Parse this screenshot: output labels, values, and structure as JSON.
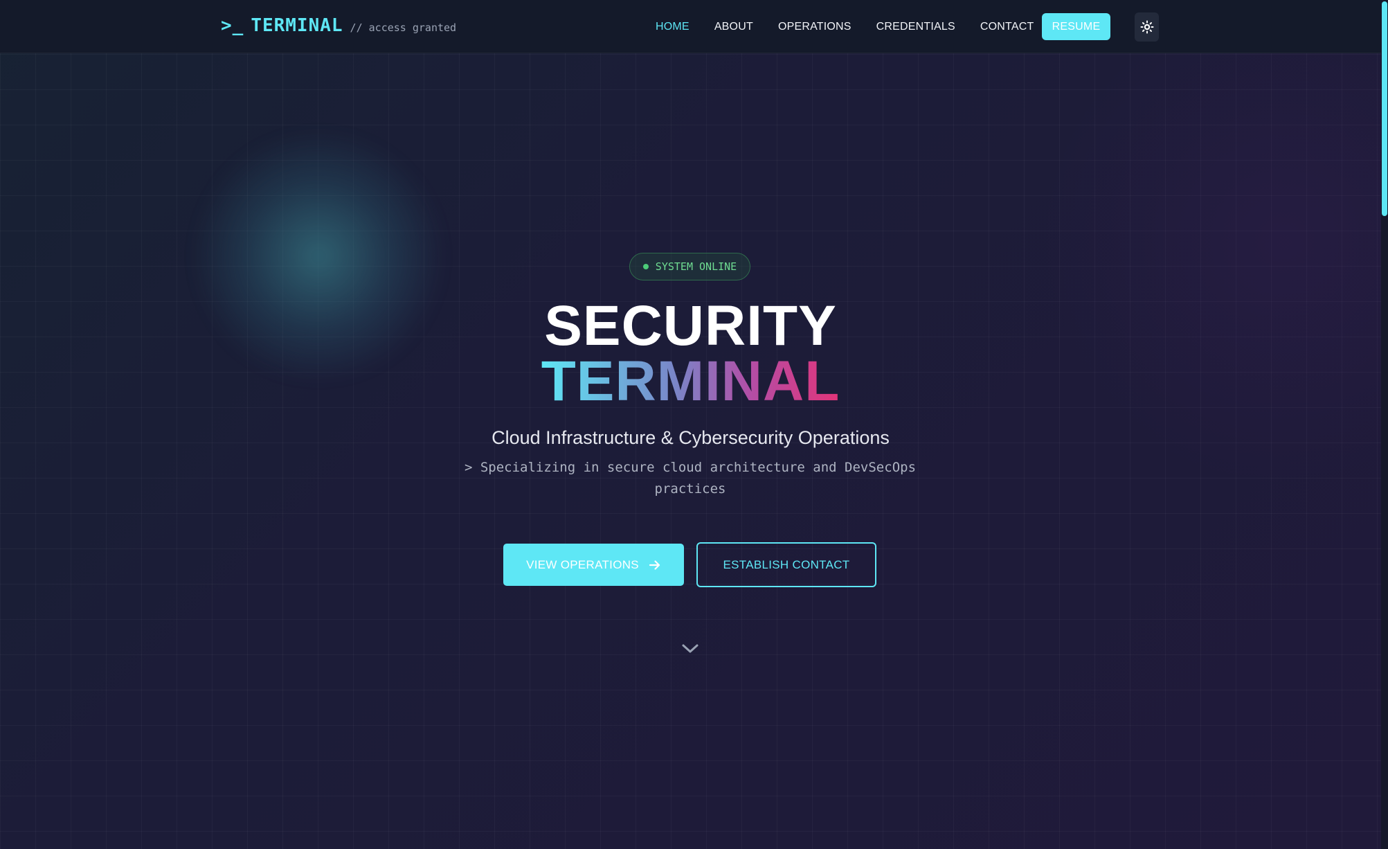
{
  "header": {
    "logo": {
      "prompt": ">_",
      "name": "TERMINAL",
      "tag": "// access granted"
    },
    "nav": [
      {
        "label": "HOME",
        "active": true
      },
      {
        "label": "ABOUT",
        "active": false
      },
      {
        "label": "OPERATIONS",
        "active": false
      },
      {
        "label": "CREDENTIALS",
        "active": false
      },
      {
        "label": "CONTACT",
        "active": false
      }
    ],
    "resume_label": "RESUME",
    "theme_toggle_icon": "sun-icon"
  },
  "hero": {
    "status_badge": "SYSTEM ONLINE",
    "title_line1": "SECURITY",
    "title_line2": "TERMINAL",
    "subtitle": "Cloud Infrastructure & Cybersecurity Operations",
    "tagline": "> Specializing in secure cloud architecture and DevSecOps practices",
    "primary_button": "VIEW OPERATIONS",
    "secondary_button": "ESTABLISH CONTACT",
    "scroll_icon": "chevron-down-icon"
  },
  "colors": {
    "accent": "#5ee7f5",
    "status_green": "#6fdc92",
    "gradient_end": "#e23479"
  }
}
